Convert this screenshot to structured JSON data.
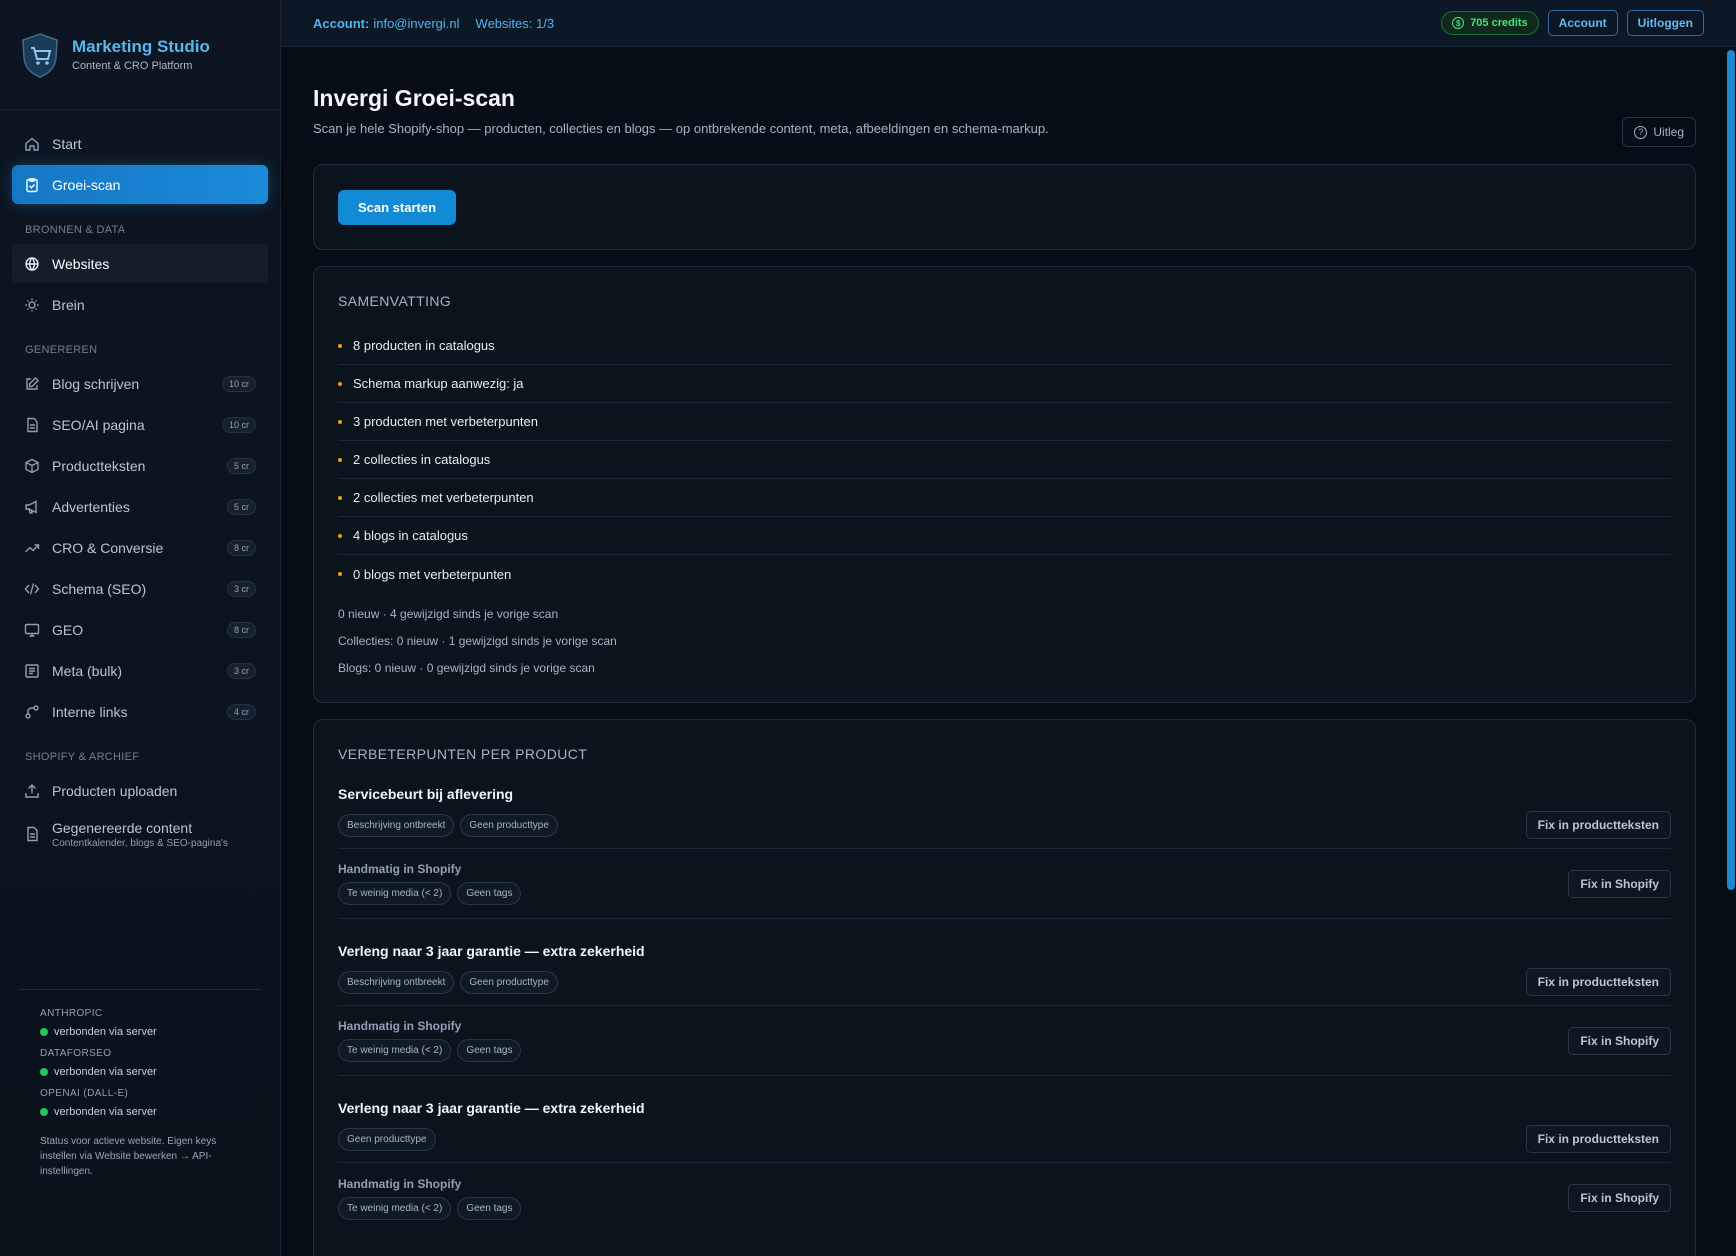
{
  "brand": {
    "title": "Marketing Studio",
    "subtitle": "Content & CRO Platform"
  },
  "nav": {
    "top": [
      {
        "label": "Start",
        "icon": "home-icon"
      },
      {
        "label": "Groei-scan",
        "icon": "clipboard-check-icon"
      }
    ],
    "sections": [
      {
        "title": "BRONNEN & DATA",
        "items": [
          {
            "label": "Websites",
            "icon": "globe-icon"
          },
          {
            "label": "Brein",
            "icon": "lightbulb-icon"
          }
        ]
      },
      {
        "title": "GENEREREN",
        "items": [
          {
            "label": "Blog schrijven",
            "icon": "edit-icon",
            "badge": "10 cr"
          },
          {
            "label": "SEO/AI pagina",
            "icon": "file-icon",
            "badge": "10 cr"
          },
          {
            "label": "Productteksten",
            "icon": "box-icon",
            "badge": "5 cr"
          },
          {
            "label": "Advertenties",
            "icon": "megaphone-icon",
            "badge": "5 cr"
          },
          {
            "label": "CRO & Conversie",
            "icon": "trending-up-icon",
            "badge": "8 cr"
          },
          {
            "label": "Schema (SEO)",
            "icon": "code-icon",
            "badge": "3 cr"
          },
          {
            "label": "GEO",
            "icon": "monitor-icon",
            "badge": "8 cr"
          },
          {
            "label": "Meta (bulk)",
            "icon": "list-icon",
            "badge": "3 cr"
          },
          {
            "label": "Interne links",
            "icon": "link-icon",
            "badge": "4 cr"
          }
        ]
      },
      {
        "title": "SHOPIFY & ARCHIEF",
        "items": [
          {
            "label": "Producten uploaden",
            "icon": "upload-icon"
          },
          {
            "label": "Gegenereerde content",
            "icon": "document-icon",
            "sub": "Contentkalender, blogs & SEO-pagina's"
          }
        ]
      }
    ]
  },
  "status": {
    "providers": [
      {
        "name": "ANTHROPIC",
        "state": "verbonden via server"
      },
      {
        "name": "DATAFORSEO",
        "state": "verbonden via server"
      },
      {
        "name": "OPENAI (DALL-E)",
        "state": "verbonden via server"
      }
    ],
    "note": "Status voor actieve website. Eigen keys instellen via Website bewerken → API-instellingen."
  },
  "topbar": {
    "account_label": "Account:",
    "account_value": "info@invergi.nl",
    "websites": "Websites: 1/3",
    "credits": "705 credits",
    "account_button": "Account",
    "logout_button": "Uitloggen"
  },
  "page": {
    "title": "Invergi Groei-scan",
    "subtitle": "Scan je hele Shopify-shop — producten, collecties en blogs — op ontbrekende content, meta, afbeeldingen en schema-markup.",
    "help_button": "Uitleg",
    "scan_button": "Scan starten"
  },
  "summary": {
    "title": "SAMENVATTING",
    "items": [
      "8 producten in catalogus",
      "Schema markup aanwezig: ja",
      "3 producten met verbeterpunten",
      "2 collecties in catalogus",
      "2 collecties met verbeterpunten",
      "4 blogs in catalogus",
      "0 blogs met verbeterpunten"
    ],
    "changes": [
      "0 nieuw · 4 gewijzigd sinds je vorige scan",
      "Collecties: 0 nieuw · 1 gewijzigd sinds je vorige scan",
      "Blogs: 0 nieuw · 0 gewijzigd sinds je vorige scan"
    ]
  },
  "products": {
    "title": "VERBETERPUNTEN PER PRODUCT",
    "manual_label": "Handmatig in Shopify",
    "fix_texts_button": "Fix in productteksten",
    "fix_shopify_button": "Fix in Shopify",
    "items": [
      {
        "name": "Servicebeurt bij aflevering",
        "auto_tags": [
          "Beschrijving ontbreekt",
          "Geen producttype"
        ],
        "manual_tags": [
          "Te weinig media (< 2)",
          "Geen tags"
        ]
      },
      {
        "name": "Verleng naar 3 jaar garantie — extra zekerheid",
        "auto_tags": [
          "Beschrijving ontbreekt",
          "Geen producttype"
        ],
        "manual_tags": [
          "Te weinig media (< 2)",
          "Geen tags"
        ]
      },
      {
        "name": "Verleng naar 3 jaar garantie — extra zekerheid",
        "auto_tags": [
          "Geen producttype"
        ],
        "manual_tags": [
          "Te weinig media (< 2)",
          "Geen tags"
        ]
      }
    ]
  }
}
